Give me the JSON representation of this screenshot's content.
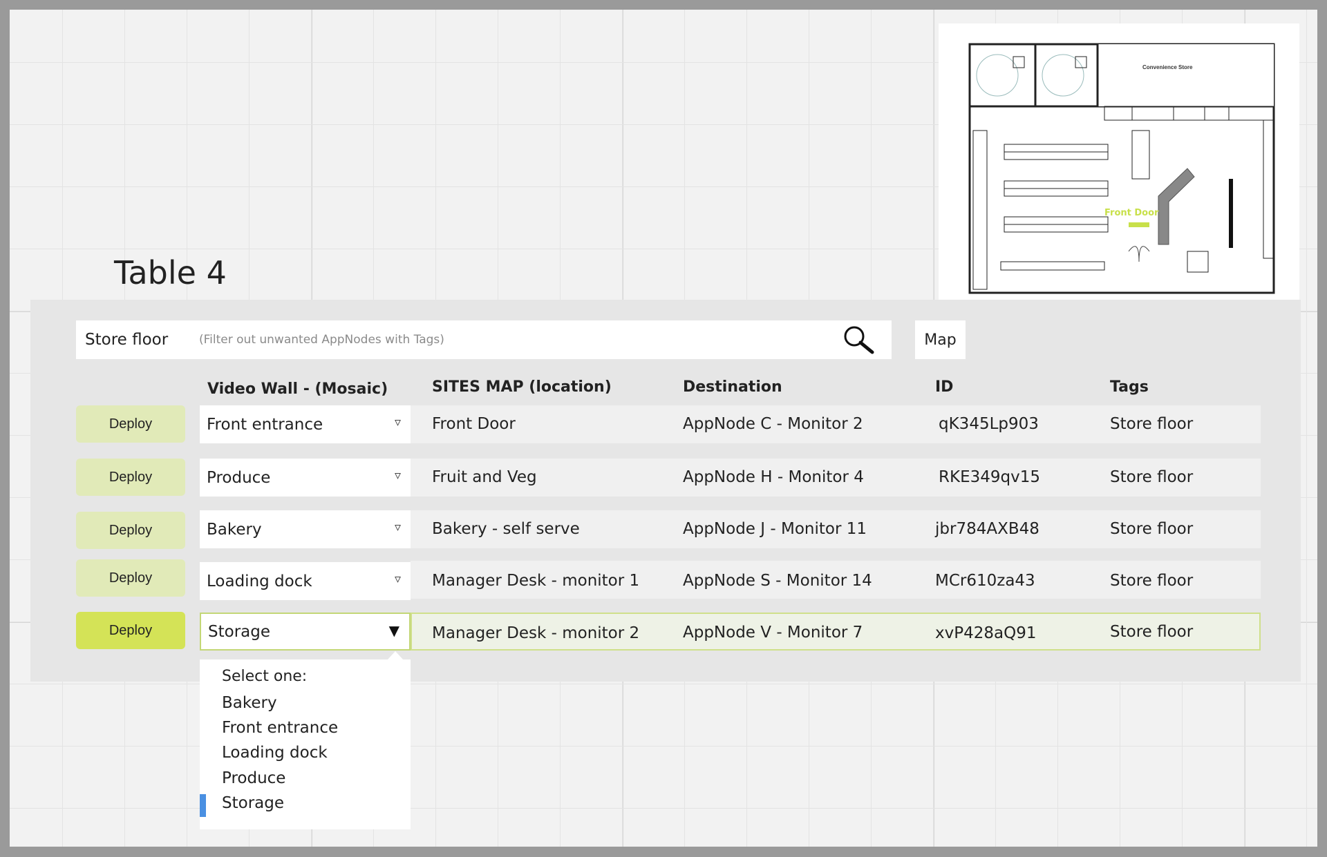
{
  "title": "Table 4",
  "search": {
    "tag": "Store floor",
    "placeholder": "(Filter out unwanted AppNodes with Tags)"
  },
  "map_button": "Map",
  "floorplan": {
    "store_title": "Convenience Store",
    "front_door_label": "Front Door",
    "front_door_color": "#c8e04a"
  },
  "headers": {
    "video_wall": "Video Wall - (Mosaic)",
    "sites_map": "SITES MAP (location)",
    "destination": "Destination",
    "id": "ID",
    "tags": "Tags"
  },
  "rows": [
    {
      "deploy": "Deploy",
      "video_wall": "Front entrance",
      "sites_map": "Front Door",
      "destination": "AppNode C - Monitor 2",
      "id": "qK345Lp903",
      "tags": "Store floor"
    },
    {
      "deploy": "Deploy",
      "video_wall": "Produce",
      "sites_map": "Fruit and Veg",
      "destination": "AppNode H - Monitor 4",
      "id": "RKE349qv15",
      "tags": "Store floor"
    },
    {
      "deploy": "Deploy",
      "video_wall": "Bakery",
      "sites_map": "Bakery - self serve",
      "destination": "AppNode J - Monitor 11",
      "id": "jbr784AXB48",
      "tags": "Store floor"
    },
    {
      "deploy": "Deploy",
      "video_wall": "Loading dock",
      "sites_map": "Manager Desk - monitor 1",
      "destination": "AppNode S - Monitor 14",
      "id": "MCr610za43",
      "tags": "Store floor"
    },
    {
      "deploy": "Deploy",
      "video_wall": "Storage",
      "sites_map": "Manager Desk - monitor 2",
      "destination": "AppNode V - Monitor 7",
      "id": "xvP428aQ91",
      "tags": "Store floor"
    }
  ],
  "dropdown": {
    "prompt": "Select one:",
    "options": [
      "Bakery",
      "Front entrance",
      "Loading dock",
      "Produce",
      "Storage"
    ],
    "selected": "Storage"
  },
  "icons": {
    "closed_arrow": "▿",
    "open_arrow": "▼"
  },
  "colors": {
    "deploy_bg": "#e1eab8",
    "deploy_active_bg": "#d4e357",
    "selection_marker": "#4a90e2"
  }
}
